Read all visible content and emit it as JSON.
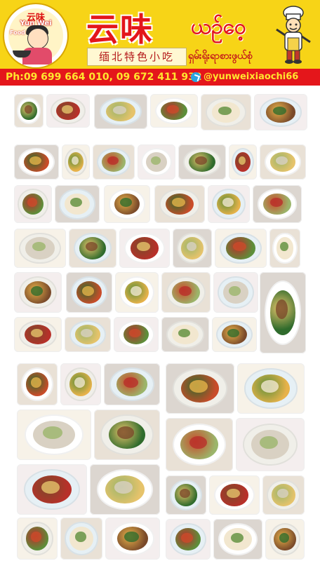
{
  "header": {
    "logo_top_text": "云味",
    "logo_sub1": "Yun Wei",
    "logo_sub2": "Food",
    "title_cn": "云味",
    "title_mm": "ယဉ်ဝေ့",
    "subtitle_cn": "缅北特色小吃",
    "subtitle_mm": "ရှမ်းရိုးရာစားဖွယ်စုံ",
    "bg_color": "#f7d417",
    "accent_color": "#e3161b"
  },
  "contact": {
    "phone_text": "Ph:09 699 664 010, 09 672 411 932",
    "telegram_icon": "telegram-icon",
    "handle_text": "@yunweixiaochi66",
    "bg_color": "#e4161b",
    "text_color": "#ffe52e"
  },
  "dish_palette": [
    "#2f6b2c",
    "#b8302a",
    "#e6c36b",
    "#5c8f3a",
    "#f2e7cf",
    "#7a4a2a",
    "#c94c2a",
    "#e7b24a",
    "#9bb56b",
    "#d9d1c3"
  ]
}
